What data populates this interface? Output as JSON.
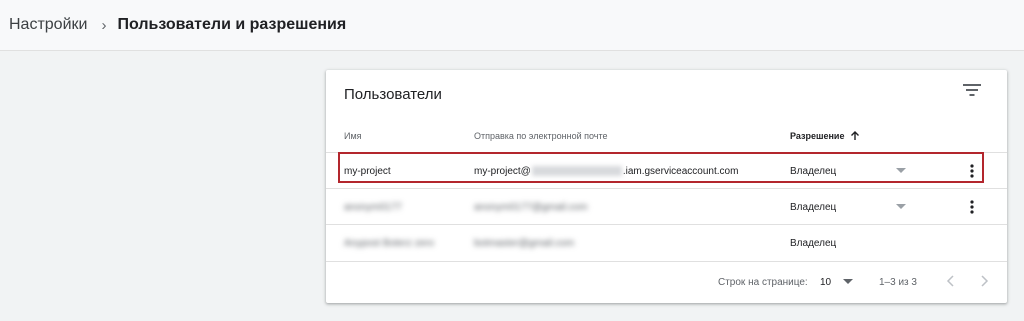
{
  "breadcrumb": {
    "parent": "Настройки",
    "separator": "›",
    "current": "Пользователи и разрешения"
  },
  "card": {
    "title": "Пользователи",
    "filter_icon": "filter-list-icon"
  },
  "table": {
    "columns": {
      "name": "Имя",
      "email": "Отправка по электронной почте",
      "role": "Разрешение",
      "sort_icon": "arrow-up-icon"
    },
    "rows": [
      {
        "name": "my-project",
        "email_prefix": "my-project@",
        "email_suffix": ".iam.gserviceaccount.com",
        "role": "Владелец",
        "has_dropdown": true,
        "has_menu": true,
        "highlighted": true
      },
      {
        "name": "anonym0177",
        "email_full": "anonym0177@gmail.com",
        "role": "Владелец",
        "has_dropdown": true,
        "has_menu": true
      },
      {
        "name": "Anypost Boterz zero",
        "email_full": "botmaster@gmail.com",
        "role": "Владелец",
        "has_dropdown": false,
        "has_menu": false
      }
    ]
  },
  "pagination": {
    "rows_per_page_label": "Строк на странице:",
    "rows_per_page_value": "10",
    "range": "1–3 из 3"
  },
  "colors": {
    "highlight_border": "#b3262d",
    "background": "#f1f3f4"
  }
}
